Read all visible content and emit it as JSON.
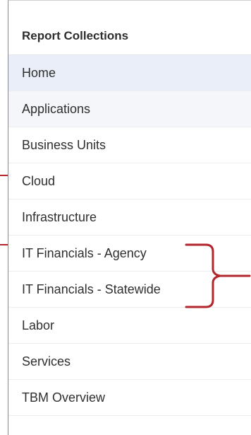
{
  "panel": {
    "title": "Report Collections",
    "items": [
      {
        "label": "Home",
        "state": "active"
      },
      {
        "label": "Applications",
        "state": "hover"
      },
      {
        "label": "Business Units",
        "state": ""
      },
      {
        "label": "Cloud",
        "state": ""
      },
      {
        "label": "Infrastructure",
        "state": ""
      },
      {
        "label": "IT Financials - Agency",
        "state": ""
      },
      {
        "label": "IT Financials - Statewide",
        "state": ""
      },
      {
        "label": "Labor",
        "state": ""
      },
      {
        "label": "Services",
        "state": ""
      },
      {
        "label": "TBM Overview",
        "state": ""
      }
    ]
  },
  "annotations": {
    "color": "#b3262c",
    "shapes": [
      "rectangle-outline",
      "curly-brace"
    ]
  }
}
